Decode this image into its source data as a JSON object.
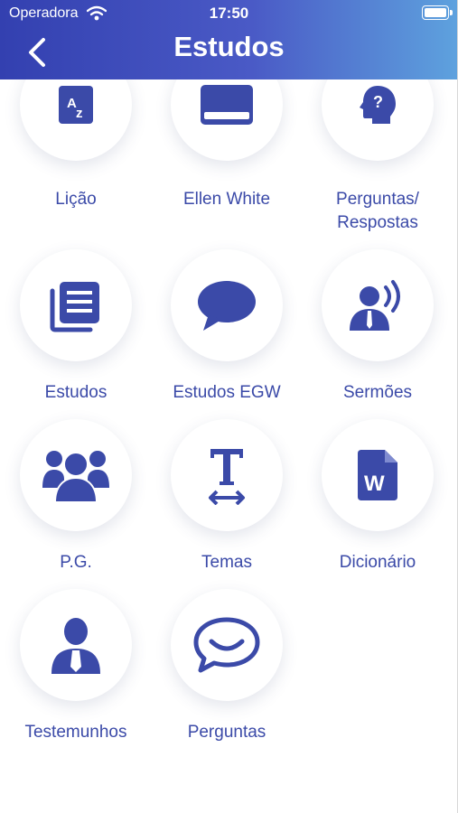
{
  "status_bar": {
    "carrier": "Operadora",
    "time": "17:50"
  },
  "header": {
    "title": "Estudos"
  },
  "items": [
    {
      "label": "Lição"
    },
    {
      "label": "Ellen White"
    },
    {
      "label": "Perguntas/\nRespostas"
    },
    {
      "label": "Estudos"
    },
    {
      "label": "Estudos EGW"
    },
    {
      "label": "Sermões"
    },
    {
      "label": "P.G."
    },
    {
      "label": "Temas"
    },
    {
      "label": "Dicionário"
    },
    {
      "label": "Testemunhos"
    },
    {
      "label": "Perguntas"
    }
  ],
  "colors": {
    "accent": "#3b4aa8",
    "header_start": "#3340b0",
    "header_end": "#5ea2de"
  }
}
